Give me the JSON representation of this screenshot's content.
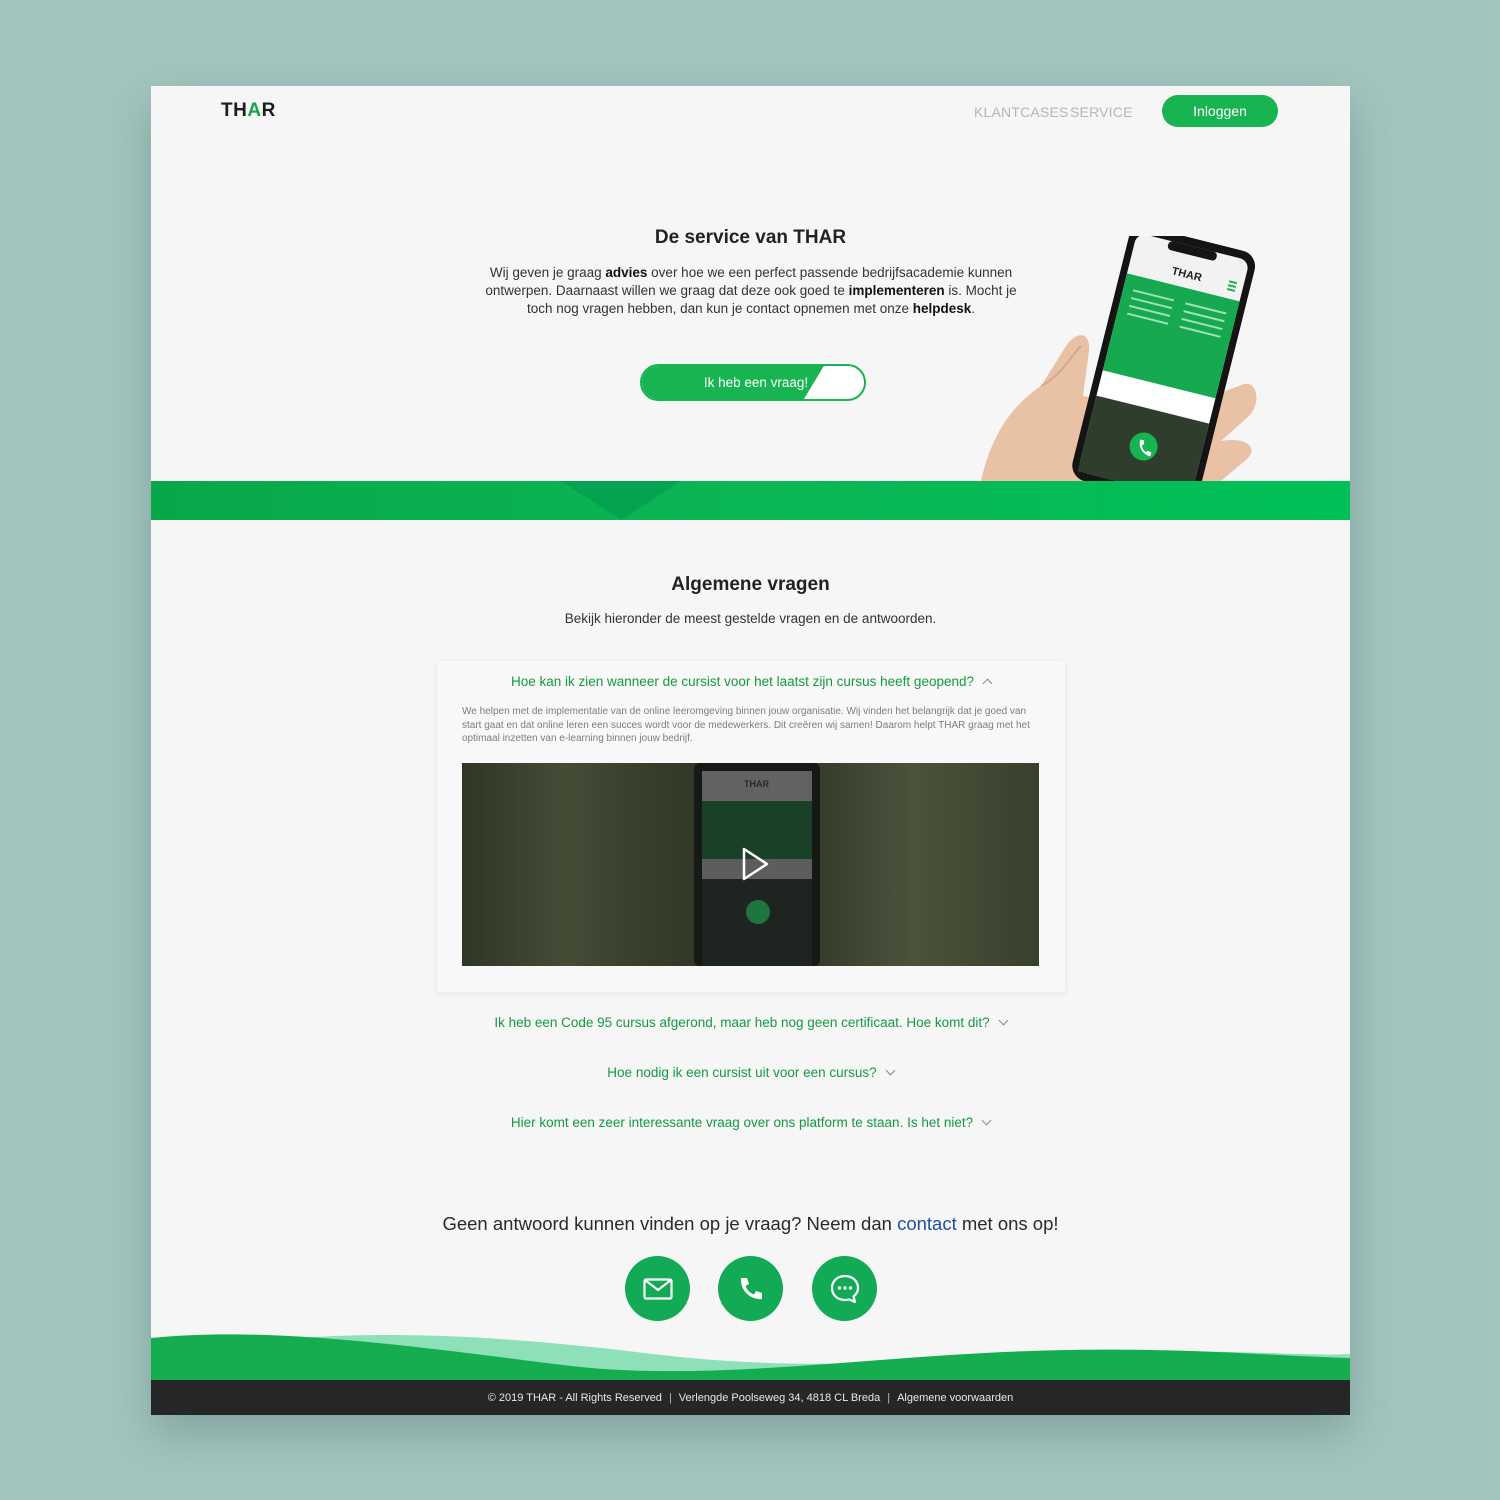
{
  "header": {
    "logo_prefix": "TH",
    "logo_accent": "A",
    "logo_suffix": "R",
    "nav": [
      "KLANTCASES",
      "SERVICE"
    ],
    "login_label": "Inloggen"
  },
  "hero": {
    "title": "De service van THAR",
    "text_1": "Wij geven je graag ",
    "bold_1": "advies",
    "text_2": " over hoe we een perfect passende bedrijfsacademie kunnen ontwerpen. Daarnaast willen we graag dat deze ook goed te ",
    "bold_2": "implementeren",
    "text_3": " is. Mocht je toch nog vragen hebben, dan kun je contact opnemen met onze ",
    "bold_3": "helpdesk",
    "text_4": ".",
    "button_label": "Ik heb een vraag!",
    "phone_logo": "THAR"
  },
  "faq": {
    "title": "Algemene vragen",
    "subtitle": "Bekijk hieronder de meest gestelde vragen en de antwoorden.",
    "open_item": {
      "question": "Hoe kan ik zien wanneer de cursist voor het laatst zijn cursus heeft geopend?",
      "answer": "We helpen met de implementatie van de online leeromgeving binnen jouw organisatie. Wij vinden het belangrijk dat je goed van start gaat en dat online leren een succes wordt voor de medewerkers. Dit creëren wij samen! Daarom helpt THAR graag met het optimaal inzetten van e-learning binnen jouw bedrijf.",
      "video_logo": "THAR"
    },
    "items": [
      "Ik heb een Code 95 cursus afgerond, maar heb nog geen certificaat. Hoe komt dit?",
      "Hoe nodig ik een cursist uit voor een cursus?",
      "Hier komt een zeer interessante vraag over ons platform te staan. Is het niet?"
    ]
  },
  "contact": {
    "text_before": "Geen antwoord kunnen vinden op je vraag? Neem dan ",
    "link_label": "contact",
    "text_after": " met ons op!",
    "icons": [
      "mail-icon",
      "phone-icon",
      "chat-icon"
    ]
  },
  "footer": {
    "copyright": "© 2019 THAR - All Rights Reserved",
    "address": "Verlengde Poolseweg 34, 4818 CL Breda",
    "terms": "Algemene voorwaarden",
    "separator": "|"
  },
  "colors": {
    "accent": "#17b451",
    "link": "#1f4fa3",
    "background": "#a3c5bf",
    "footer": "#262626"
  }
}
